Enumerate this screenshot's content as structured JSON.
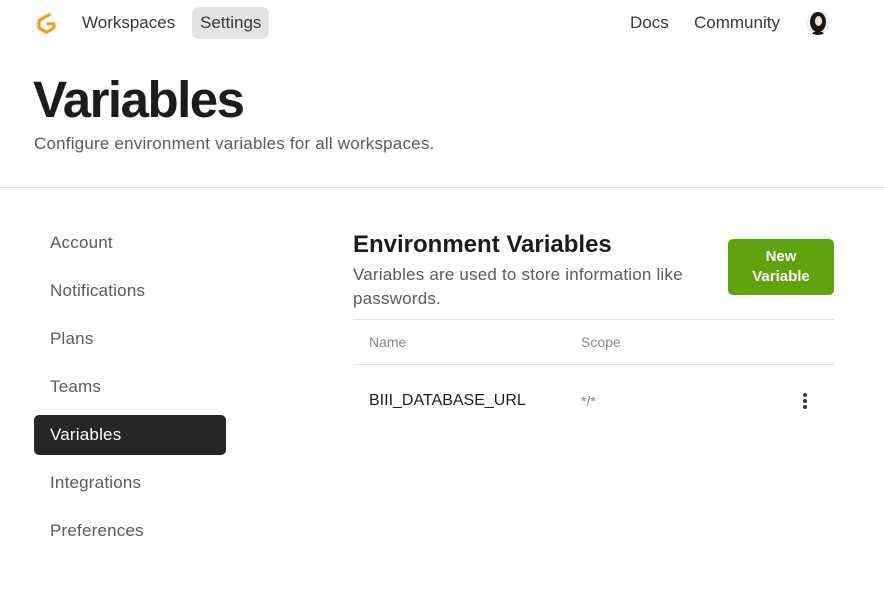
{
  "topbar": {
    "nav": {
      "workspaces": "Workspaces",
      "settings": "Settings",
      "docs": "Docs",
      "community": "Community"
    },
    "logo_icon": "gitpod-logo-icon",
    "avatar_icon": "user-avatar-icon"
  },
  "page": {
    "title": "Variables",
    "subtitle": "Configure environment variables for all workspaces."
  },
  "sidebar": {
    "items": [
      {
        "label": "Account",
        "active": false
      },
      {
        "label": "Notifications",
        "active": false
      },
      {
        "label": "Plans",
        "active": false
      },
      {
        "label": "Teams",
        "active": false
      },
      {
        "label": "Variables",
        "active": true
      },
      {
        "label": "Integrations",
        "active": false
      },
      {
        "label": "Preferences",
        "active": false
      }
    ]
  },
  "main": {
    "title": "Environment Variables",
    "description": "Variables are used to store information like passwords.",
    "new_button": {
      "line1": "New",
      "line2": "Variable"
    },
    "table": {
      "columns": [
        "Name",
        "Scope"
      ],
      "rows": [
        {
          "name": "BIII_DATABASE_URL",
          "scope": "*/*",
          "menu_icon": "more-vertical-icon"
        }
      ]
    }
  },
  "colors": {
    "accent_green": "#5fa30f",
    "logo_orange": "#f5a623",
    "active_sidebar_bg": "#282525",
    "nav_active_bg": "#e6e4e2"
  }
}
